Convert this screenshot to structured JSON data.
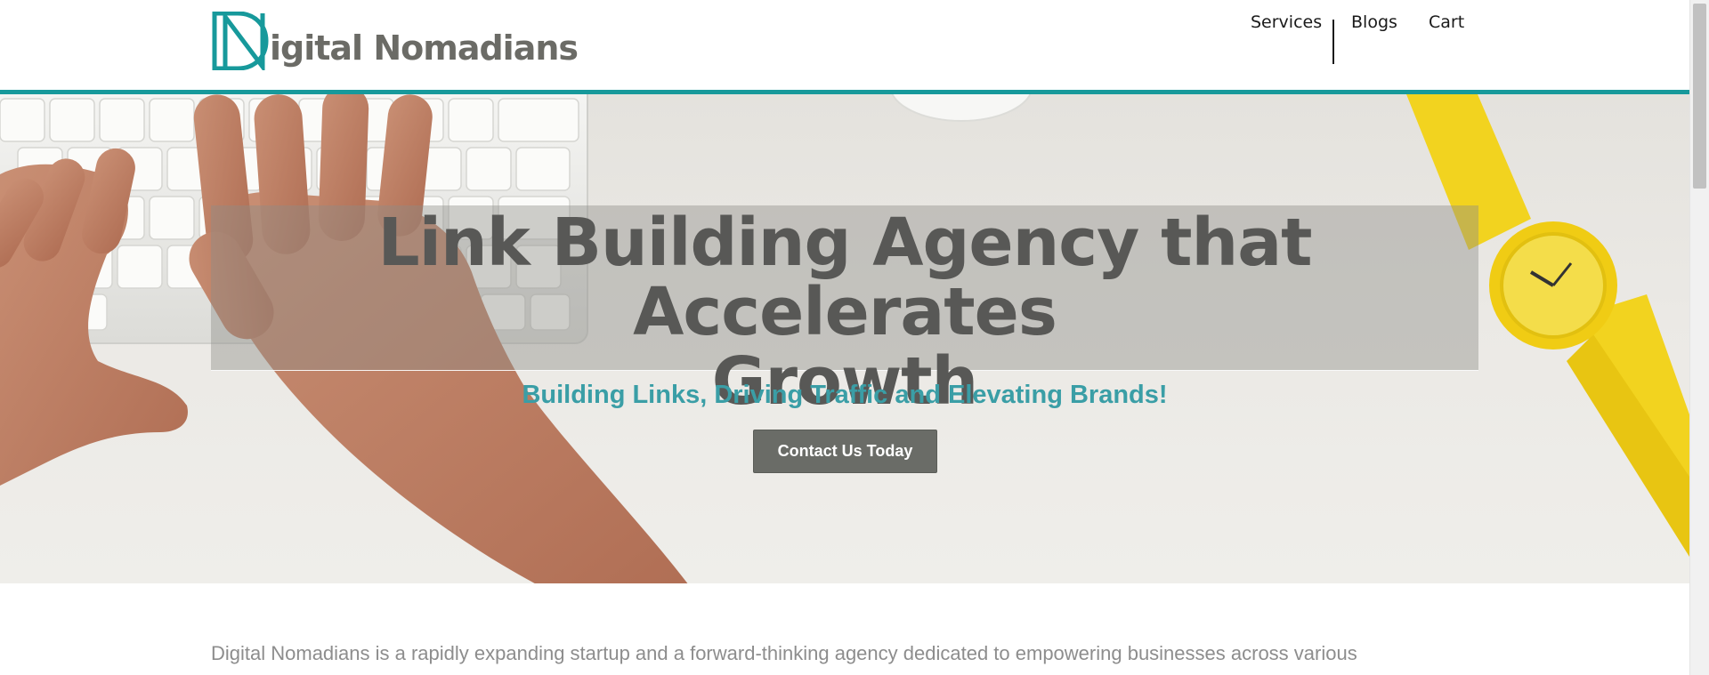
{
  "brand": {
    "name": "igital Nomadians",
    "mark_letters": "DN",
    "accent_color": "#17999b",
    "text_color": "#6b6b66"
  },
  "nav": {
    "items": [
      {
        "label": "Services"
      },
      {
        "label": "Blogs"
      },
      {
        "label": "Cart"
      }
    ]
  },
  "hero": {
    "title_line1": "Link Building Agency that Accelerates",
    "title_line2": "Growth",
    "subtitle": "Building Links, Driving Traffic and Elevating Brands!",
    "cta_label": "Contact Us Today",
    "image_description_icons": [
      "keyboard-image",
      "hands-image",
      "mouse-image",
      "watch-image"
    ]
  },
  "intro": {
    "text": "Digital Nomadians is a rapidly expanding startup and a forward-thinking  agency dedicated to empowering businesses across various"
  }
}
